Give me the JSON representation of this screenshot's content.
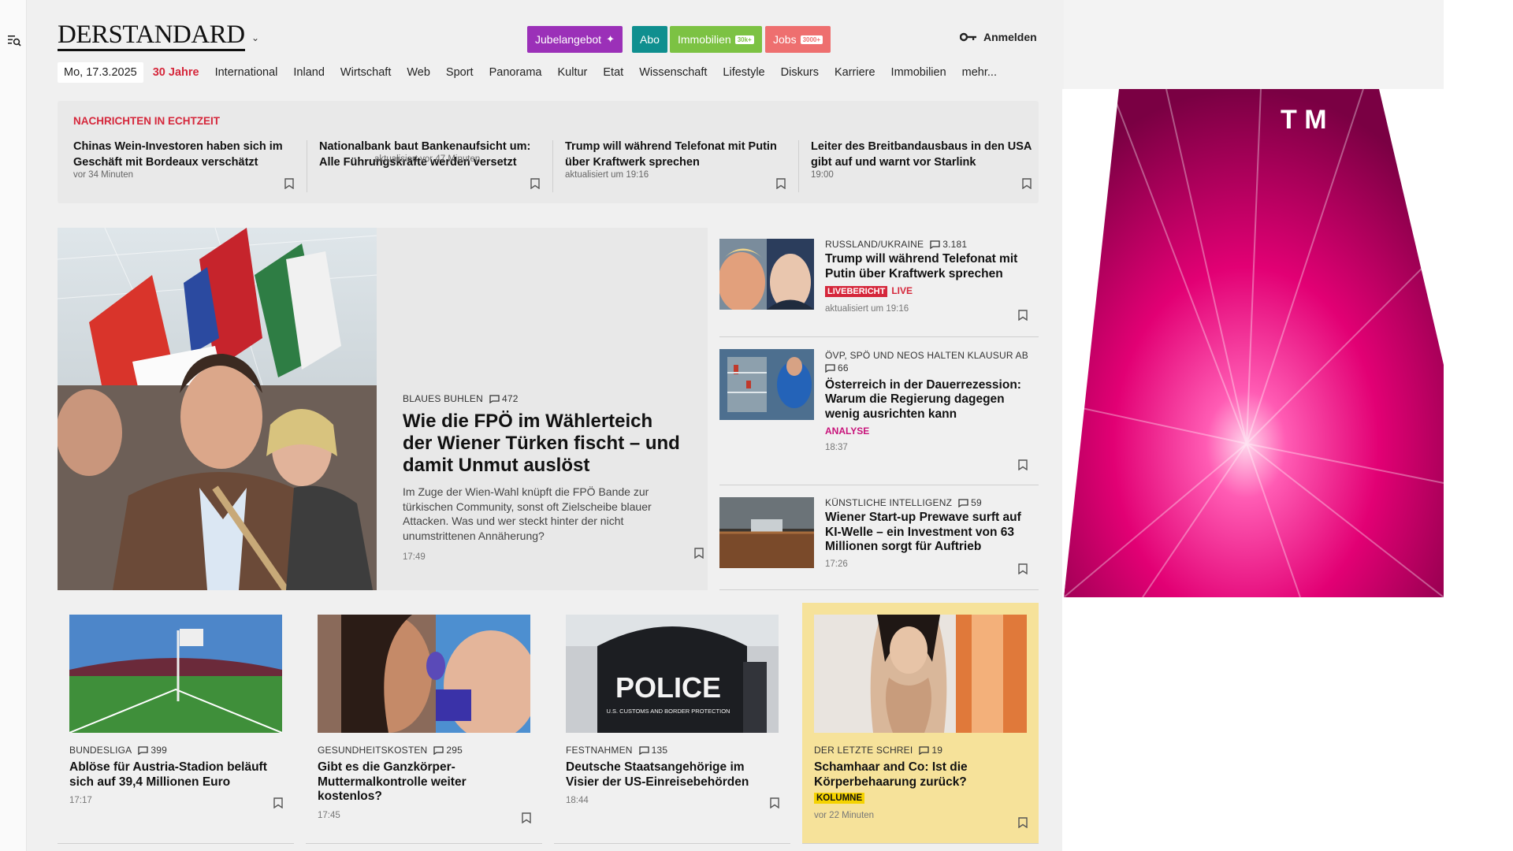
{
  "header": {
    "logo": "DERSTANDARD",
    "promos": [
      {
        "label": "Jubelangebot",
        "color": "#9b30b8"
      },
      {
        "label": "Abo",
        "color": "#0f8f8f"
      },
      {
        "label": "Immobilien",
        "tag": "30k+",
        "color": "#7cc243"
      },
      {
        "label": "Jobs",
        "tag": "3000+",
        "color": "#ee6f6f"
      }
    ],
    "login": "Anmelden"
  },
  "nav": {
    "date": "Mo, 17.3.2025",
    "items": [
      "30 Jahre",
      "International",
      "Inland",
      "Wirtschaft",
      "Web",
      "Sport",
      "Panorama",
      "Kultur",
      "Etat",
      "Wissenschaft",
      "Lifestyle",
      "Diskurs",
      "Karriere",
      "Immobilien",
      "mehr..."
    ]
  },
  "ticker": {
    "title": "NACHRICHTEN IN ECHTZEIT",
    "items": [
      {
        "title": "Chinas Wein-Investoren haben sich im Geschäft mit Bordeaux verschätzt",
        "meta": "vor 34 Minuten"
      },
      {
        "title": "Nationalbank baut Bankenaufsicht um: Alle Führungskräfte werden versetzt",
        "meta": "aktualisiert vor 47 Minuten"
      },
      {
        "title": "Trump will während Telefonat mit Putin über Kraftwerk sprechen",
        "meta": "aktualisiert um 19:16"
      },
      {
        "title": "Leiter des Breitbandausbaus in den USA gibt auf und warnt vor Starlink",
        "meta": "19:00"
      }
    ]
  },
  "hero": {
    "kicker": "BLAUES BUHLEN",
    "comments": "472",
    "title": "Wie die FPÖ im Wählerteich der Wiener Türken fischt – und damit Unmut auslöst",
    "teaser": "Im Zuge der Wien-Wahl knüpft die FPÖ Bande zur türkischen Community, sonst oft Zielscheibe blauer Attacken. Was und wer steckt hinter der nicht unumstrittenen Annäherung?",
    "time": "17:49"
  },
  "side": [
    {
      "kicker": "RUSSLAND/UKRAINE",
      "comments": "3.181",
      "title": "Trump will während Telefonat mit Putin über Kraftwerk sprechen",
      "badge": "LIVEBERICHT",
      "live": "LIVE",
      "meta": "aktualisiert um 19:16"
    },
    {
      "kicker": "ÖVP, SPÖ UND NEOS HALTEN KLAUSUR AB",
      "comments": "66",
      "title": "Österreich in der Dauerrezession: Warum die Regierung dagegen wenig ausrichten kann",
      "label": "ANALYSE",
      "meta": "18:37"
    },
    {
      "kicker": "KÜNSTLICHE INTELLIGENZ",
      "comments": "59",
      "title": "Wiener Start-up Prewave surft auf KI-Welle – ein Investment von 63 Millionen sorgt für Auftrieb",
      "meta": "17:26"
    }
  ],
  "cards": [
    {
      "kicker": "BUNDESLIGA",
      "comments": "399",
      "title": "Ablöse für Austria-Stadion beläuft sich auf 39,4 Millionen Euro",
      "meta": "17:17"
    },
    {
      "kicker": "GESUNDHEITSKOSTEN",
      "comments": "295",
      "title": "Gibt es die Ganzkörper-Muttermalkontrolle weiter kostenlos?",
      "meta": "17:45"
    },
    {
      "kicker": "FESTNAHMEN",
      "comments": "135",
      "title": "Deutsche Staatsangehörige im Visier der US-Einreisebehörden",
      "meta": "18:44",
      "img_text": "POLICE",
      "img_sub": "U.S. CUSTOMS AND BORDER PROTECTION"
    },
    {
      "kicker": "DER LETZTE SCHREI",
      "comments": "19",
      "title": "Schamhaar and Co: Ist die Körperbehaarung zurück?",
      "label": "KOLUMNE",
      "meta": "vor 22 Minuten"
    }
  ],
  "ad": {
    "brand": "T M",
    "brand_color": "#e20074"
  }
}
